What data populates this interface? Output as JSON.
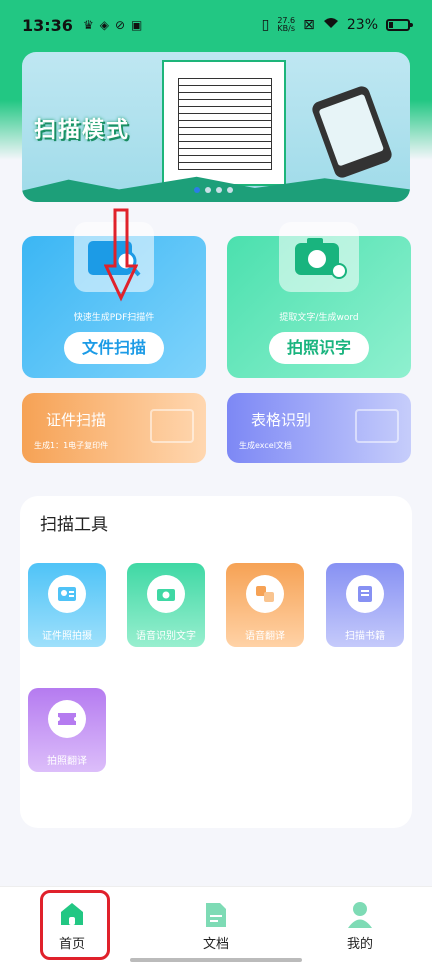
{
  "status_bar": {
    "time": "13:36",
    "net_speed": "27.6\nKB/s",
    "battery": "23%"
  },
  "banner": {
    "title": "扫描模式"
  },
  "features": {
    "scan": {
      "caption": "快速生成PDF扫描件",
      "button": "文件扫描"
    },
    "photo": {
      "caption": "提取文字/生成word",
      "button": "拍照识字"
    },
    "id": {
      "title": "证件扫描",
      "subtitle": "生成1：1电子复印件"
    },
    "table": {
      "title": "表格识别",
      "subtitle": "生成excel文档"
    }
  },
  "tools": {
    "title": "扫描工具",
    "items": [
      {
        "label": "证件照拍摄",
        "color": "#4fc3f7"
      },
      {
        "label": "语音识别文字",
        "color": "#3fd8a4"
      },
      {
        "label": "语音翻译",
        "color": "#f6a255"
      },
      {
        "label": "扫描书籍",
        "color": "#8791f3"
      },
      {
        "label": "拍照翻译",
        "color": "#b57bf0"
      }
    ]
  },
  "nav": {
    "home": "首页",
    "docs": "文档",
    "mine": "我的"
  },
  "accent": "#22c783",
  "annotation_color": "#e0212b"
}
